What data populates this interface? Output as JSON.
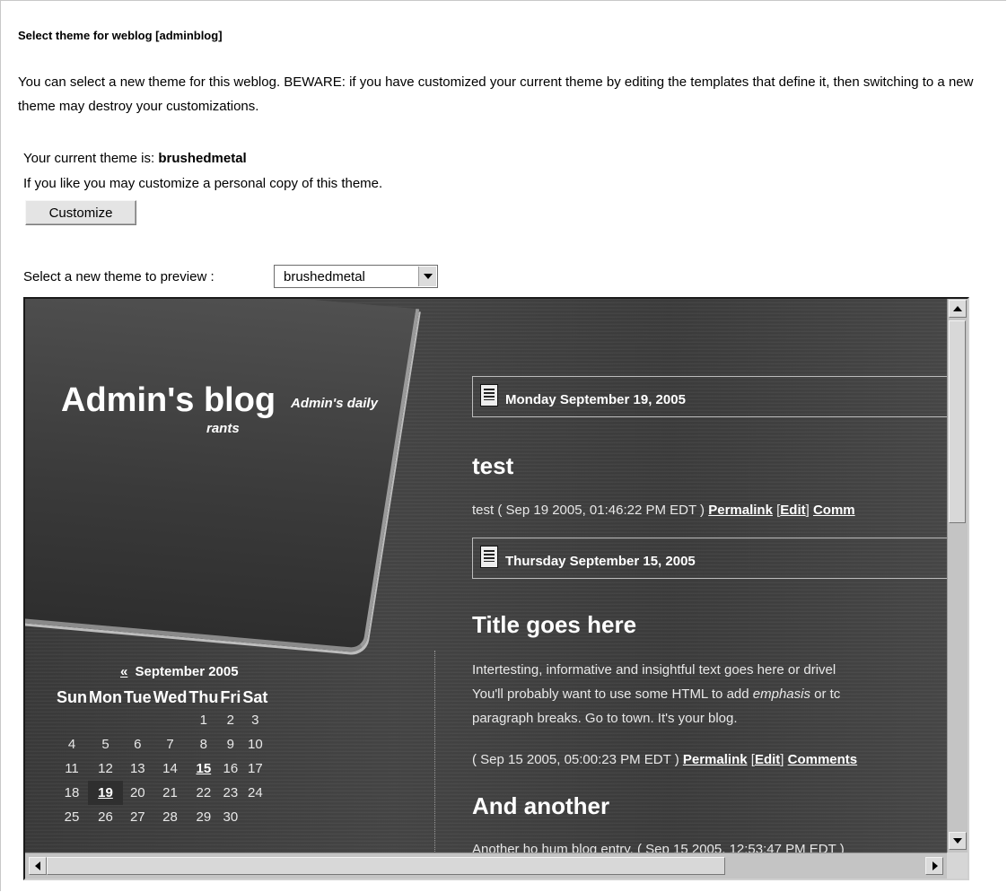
{
  "heading": "Select theme for weblog [adminblog]",
  "intro": "You can select a new theme for this weblog. BEWARE: if you have customized your current theme by editing the templates that define it, then switching to a new theme may destroy your customizations.",
  "current": {
    "label": "Your current theme is: ",
    "theme": "brushedmetal"
  },
  "copy_text": "If you like you may customize a personal copy of this theme.",
  "customize_button": "Customize",
  "preview": {
    "label": "Select a new theme to preview :",
    "selected": "brushedmetal"
  },
  "blog": {
    "title": "Admin's blog",
    "description_line1": "Admin's daily",
    "description_line2": "rants",
    "calendar": {
      "prev": "«",
      "month": "September 2005",
      "days": [
        "Sun",
        "Mon",
        "Tue",
        "Wed",
        "Thu",
        "Fri",
        "Sat"
      ],
      "weeks": [
        [
          "",
          "",
          "",
          "",
          "1",
          "2",
          "3"
        ],
        [
          "4",
          "5",
          "6",
          "7",
          "8",
          "9",
          "10"
        ],
        [
          "11",
          "12",
          "13",
          "14",
          "15",
          "16",
          "17"
        ],
        [
          "18",
          "19",
          "20",
          "21",
          "22",
          "23",
          "24"
        ],
        [
          "25",
          "26",
          "27",
          "28",
          "29",
          "30",
          ""
        ]
      ]
    },
    "day1": "Monday September 19, 2005",
    "post1": {
      "title": "test",
      "meta": "test ( Sep 19 2005, 01:46:22 PM EDT )",
      "permalink": "Permalink",
      "edit": "Edit",
      "comments": "Comm"
    },
    "day2": "Thursday September 15, 2005",
    "post2": {
      "title": "Title goes here",
      "line1": "Intertesting, informative and insightful text goes here or drivel",
      "line2a": "You'll probably want to use some HTML to add ",
      "line2em": "emphasis",
      "line2b": " or tc",
      "line3": "paragraph breaks. Go to town. It's your blog.",
      "meta": "( Sep 15 2005, 05:00:23 PM EDT )",
      "permalink": "Permalink",
      "edit": "Edit",
      "comments": "Comments"
    },
    "post3": {
      "title": "And another",
      "text": "Another ho hum blog entry. ( Sep 15 2005, 12:53:47 PM EDT )"
    }
  }
}
